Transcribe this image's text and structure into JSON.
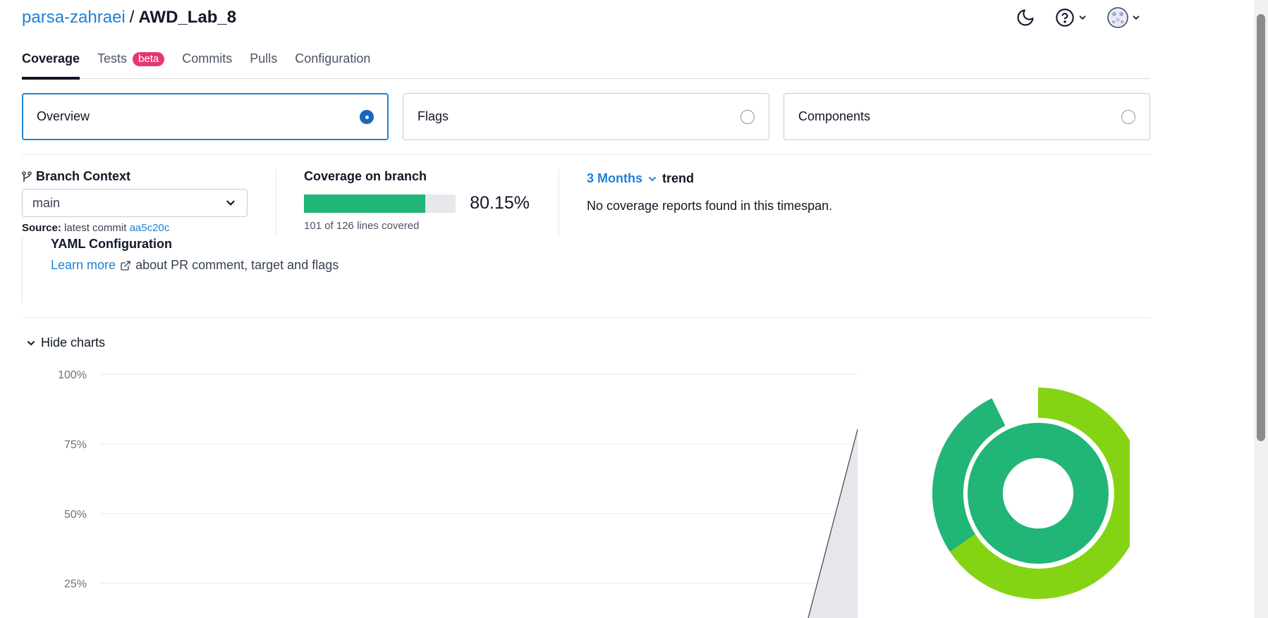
{
  "header": {
    "owner": "parsa-zahraei",
    "separator": "/",
    "repo": "AWD_Lab_8"
  },
  "tabs": [
    {
      "label": "Coverage",
      "active": true
    },
    {
      "label": "Tests",
      "badge": "beta"
    },
    {
      "label": "Commits"
    },
    {
      "label": "Pulls"
    },
    {
      "label": "Configuration"
    }
  ],
  "cards": [
    {
      "label": "Overview",
      "selected": true
    },
    {
      "label": "Flags",
      "selected": false
    },
    {
      "label": "Components",
      "selected": false
    }
  ],
  "branch_context": {
    "title": "Branch Context",
    "selected": "main",
    "source_label": "Source:",
    "source_text": "latest commit",
    "commit": "aa5c20c"
  },
  "coverage": {
    "title": "Coverage on branch",
    "percent_text": "80.15%",
    "percent": 80.15,
    "lines_text": "101 of 126 lines covered"
  },
  "trend": {
    "range": "3 Months",
    "suffix": "trend",
    "message": "No coverage reports found in this timespan."
  },
  "yaml": {
    "title": "YAML Configuration",
    "link": "Learn more",
    "text": "about PR comment, target and flags"
  },
  "charts_toggle": "Hide charts",
  "chart_data": {
    "type": "area",
    "y_ticks": [
      "100%",
      "75%",
      "50%",
      "25%"
    ],
    "ylim": [
      0,
      100
    ],
    "grid": true,
    "series": [
      {
        "values": [
          0,
          80.15
        ]
      }
    ]
  },
  "colors": {
    "accent": "#2181d8",
    "coverage_green": "#21b577",
    "sunburst_outer": "#84d414",
    "sunburst_inner": "#21b577",
    "beta_badge": "#e6366f"
  },
  "icons": {
    "theme": "moon-icon",
    "help": "help-circle-icon",
    "avatar": "avatar"
  }
}
